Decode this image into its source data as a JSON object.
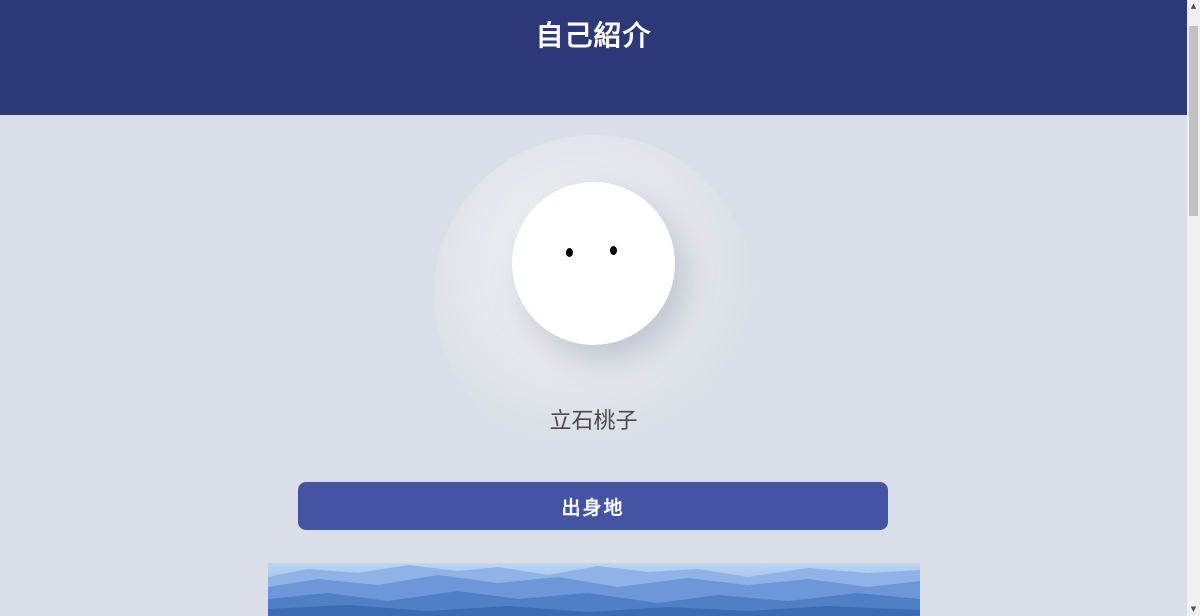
{
  "header": {
    "title": "自己紹介"
  },
  "profile": {
    "avatar_icon": "smiley-face-icon",
    "name": "立石桃子"
  },
  "section": {
    "button_label": "出身地"
  },
  "photo": {
    "description_icon": "mountain-landscape-image"
  },
  "scrollbar": {
    "up_glyph": "▲",
    "down_glyph": "▼"
  },
  "colors": {
    "header_bg": "#2c3877",
    "page_bg": "#dadee6",
    "button_bg": "#4453a3"
  }
}
